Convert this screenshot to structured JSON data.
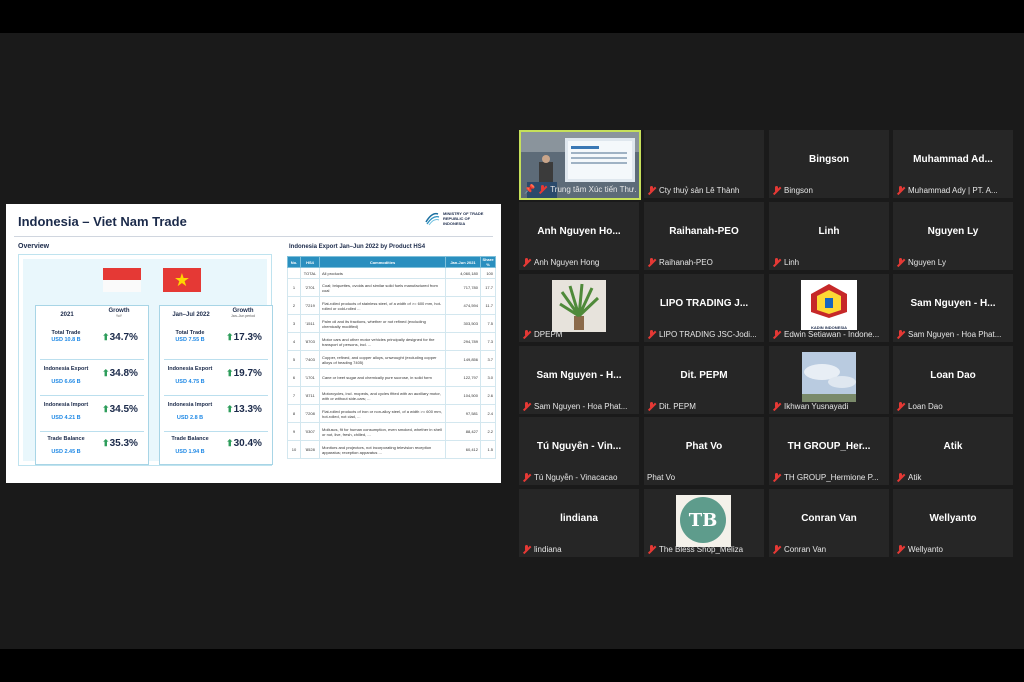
{
  "slide": {
    "title": "Indonesia – Viet Nam Trade",
    "ministry": "MINISTRY OF TRADE REPUBLIC OF INDONESIA",
    "overview_label": "Overview",
    "left_card": {
      "header_year": "2021",
      "header_growth": "Growth",
      "header_growth_sub": "YoY",
      "rows": [
        {
          "label": "Total Trade",
          "value": "USD 10.8 B",
          "growth": "34.7%"
        },
        {
          "label": "Indonesia Export",
          "value": "USD 6.66 B",
          "growth": "34.8%"
        },
        {
          "label": "Indonesia Import",
          "value": "USD 4.21 B",
          "growth": "34.5%"
        },
        {
          "label": "Trade Balance",
          "value": "USD 2.45 B",
          "growth": "35.3%"
        }
      ]
    },
    "right_card": {
      "header_year": "Jan–Jul 2022",
      "header_growth": "Growth",
      "header_growth_sub": "Jan–Jun period",
      "rows": [
        {
          "label": "Total Trade",
          "value": "USD 7.55 B",
          "growth": "17.3%"
        },
        {
          "label": "Indonesia Export",
          "value": "USD 4.75 B",
          "growth": "19.7%"
        },
        {
          "label": "Indonesia Import",
          "value": "USD 2.8 B",
          "growth": "13.3%"
        },
        {
          "label": "Trade Balance",
          "value": "USD 1.94 B",
          "growth": "30.4%"
        }
      ]
    },
    "table": {
      "title": "Indonesia Export Jan–Jun 2022 by Product HS4",
      "headers": [
        "No.",
        "HS4",
        "Commodities",
        "Jan-Jun 2021",
        "Share %"
      ],
      "rows": [
        [
          "",
          "TOTAL",
          "All products",
          "4,060,180",
          "100"
        ],
        [
          "1",
          "'2701",
          "Coal; briquettes, ovoids and similar solid fuels manufactured from coal",
          "717,780",
          "17.7"
        ],
        [
          "2",
          "'7219",
          "Flat-rolled products of stainless steel, of a width of >= 600 mm, hot-rolled or cold-rolled ...",
          "474,594",
          "11.7"
        ],
        [
          "3",
          "'1511",
          "Palm oil and its fractions, whether or not refined (excluding chemically modified)",
          "303,503",
          "7.5"
        ],
        [
          "4",
          "'8703",
          "Motor cars and other motor vehicles principally designed for the transport of persons, incl. ...",
          "294,789",
          "7.3"
        ],
        [
          "5",
          "'7403",
          "Copper, refined, and copper alloys, unwrought (excluding copper alloys of heading 7405)",
          "149,856",
          "3.7"
        ],
        [
          "6",
          "'1701",
          "Cane or beet sugar and chemically pure sucrose, in solid form",
          "122,797",
          "3.0"
        ],
        [
          "7",
          "'8711",
          "Motorcycles, incl. mopeds, and cycles fitted with an auxiliary motor, with or without side-cars; ...",
          "104,500",
          "2.6"
        ],
        [
          "8",
          "'7208",
          "Flat-rolled products of iron or non-alloy steel, of a width >= 600 mm, hot-rolled, not clad, ...",
          "97,581",
          "2.4"
        ],
        [
          "9",
          "'0307",
          "Molluscs, fit for human consumption, even smoked, whether in shell or not, live, fresh, chilled, ...",
          "88,427",
          "2.2"
        ],
        [
          "10",
          "'8528",
          "Monitors and projectors, not incorporating television reception apparatus; reception apparatus ...",
          "60,412",
          "1.5"
        ]
      ]
    }
  },
  "participants": [
    {
      "name": "",
      "label": "Trung tâm Xúc tiến Thư...",
      "type": "video-room",
      "pinned": true,
      "active": true
    },
    {
      "name": "",
      "label": "Cty thuỷ sản Lê Thành",
      "type": "blank"
    },
    {
      "name": "Bingson",
      "label": "Bingson",
      "type": "name"
    },
    {
      "name": "Muhammad Ad...",
      "label": "Muhammad Ady | PT. A...",
      "type": "name"
    },
    {
      "name": "Anh Nguyen Ho...",
      "label": "Anh Nguyen Hong",
      "type": "name"
    },
    {
      "name": "Raihanah-PEO",
      "label": "Raihanah-PEO",
      "type": "name"
    },
    {
      "name": "Linh",
      "label": "Linh",
      "type": "name"
    },
    {
      "name": "Nguyen Ly",
      "label": "Nguyen Ly",
      "type": "name"
    },
    {
      "name": "",
      "label": "DPEPM",
      "type": "plant"
    },
    {
      "name": "LIPO TRADING J...",
      "label": "LIPO TRADING JSC-Jodi...",
      "type": "name"
    },
    {
      "name": "",
      "label": "Edwin Setiawan - Indone...",
      "type": "kadin",
      "logo_text": "KADIN INDONESIA"
    },
    {
      "name": "Sam Nguyen - H...",
      "label": "Sam Nguyen - Hoa Phat...",
      "type": "name"
    },
    {
      "name": "Sam Nguyen - H...",
      "label": "Sam Nguyen - Hoa Phat...",
      "type": "name"
    },
    {
      "name": "Dit. PEPM",
      "label": "Dit. PEPM",
      "type": "name"
    },
    {
      "name": "",
      "label": "Ikhwan Yusnayadi",
      "type": "sky"
    },
    {
      "name": "Loan Dao",
      "label": "Loan Dao",
      "type": "name"
    },
    {
      "name": "Tú Nguyễn - Vin...",
      "label": "Tú Nguyễn - Vinacacao",
      "type": "name"
    },
    {
      "name": "Phat Vo",
      "label": "Phat Vo",
      "type": "name",
      "muted": false
    },
    {
      "name": "TH GROUP_Her...",
      "label": "TH GROUP_Hermione P...",
      "type": "name"
    },
    {
      "name": "Atik",
      "label": "Atik",
      "type": "name"
    },
    {
      "name": "lindiana",
      "label": "lindiana",
      "type": "name"
    },
    {
      "name": "",
      "label": "The Bless Shop_Meliza",
      "type": "tb",
      "logo_text": "TB"
    },
    {
      "name": "Conran Van",
      "label": "Conran Van",
      "type": "name"
    },
    {
      "name": "Wellyanto",
      "label": "Wellyanto",
      "type": "name"
    }
  ],
  "colors": {
    "accent": "#c6e05a",
    "tile": "#262626",
    "growth_arrow": "#2e9d5b",
    "value_blue": "#1e88e5",
    "table_header": "#2a8fbf"
  }
}
